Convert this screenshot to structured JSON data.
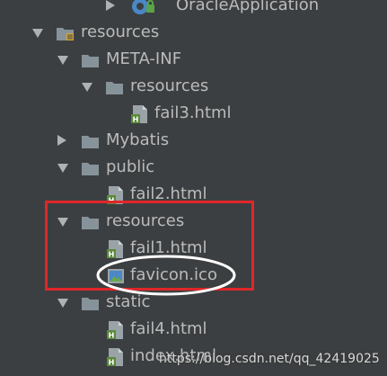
{
  "tree": {
    "oracle_app": {
      "label": "OracleApplication"
    },
    "resources_root": {
      "label": "resources"
    },
    "meta_inf": {
      "label": "META-INF"
    },
    "meta_inf_resources": {
      "label": "resources"
    },
    "fail3": {
      "label": "fail3.html"
    },
    "mybatis": {
      "label": "Mybatis"
    },
    "public": {
      "label": "public"
    },
    "fail2": {
      "label": "fail2.html"
    },
    "resources_inner": {
      "label": "resources"
    },
    "fail1": {
      "label": "fail1.html"
    },
    "favicon": {
      "label": "favicon.ico"
    },
    "static": {
      "label": "static"
    },
    "fail4": {
      "label": "fail4.html"
    },
    "index": {
      "label": "index.html"
    }
  },
  "watermark": "https://blog.csdn.net/qq_42419025",
  "colors": {
    "background": "#3c3f41",
    "text": "#bbbbbb",
    "arrow": "#afb1b3",
    "folder": "#87939a",
    "html_badge": "#5a8a3a",
    "highlight_box": "#e0262a",
    "highlight_ellipse": "#ffffff"
  },
  "icons": {
    "oracle_app": "spring-boot-run-icon",
    "folder": "folder-icon",
    "resources_root": "resources-root-folder-icon",
    "html_file": "html-file-icon",
    "ico_file": "image-file-icon"
  }
}
